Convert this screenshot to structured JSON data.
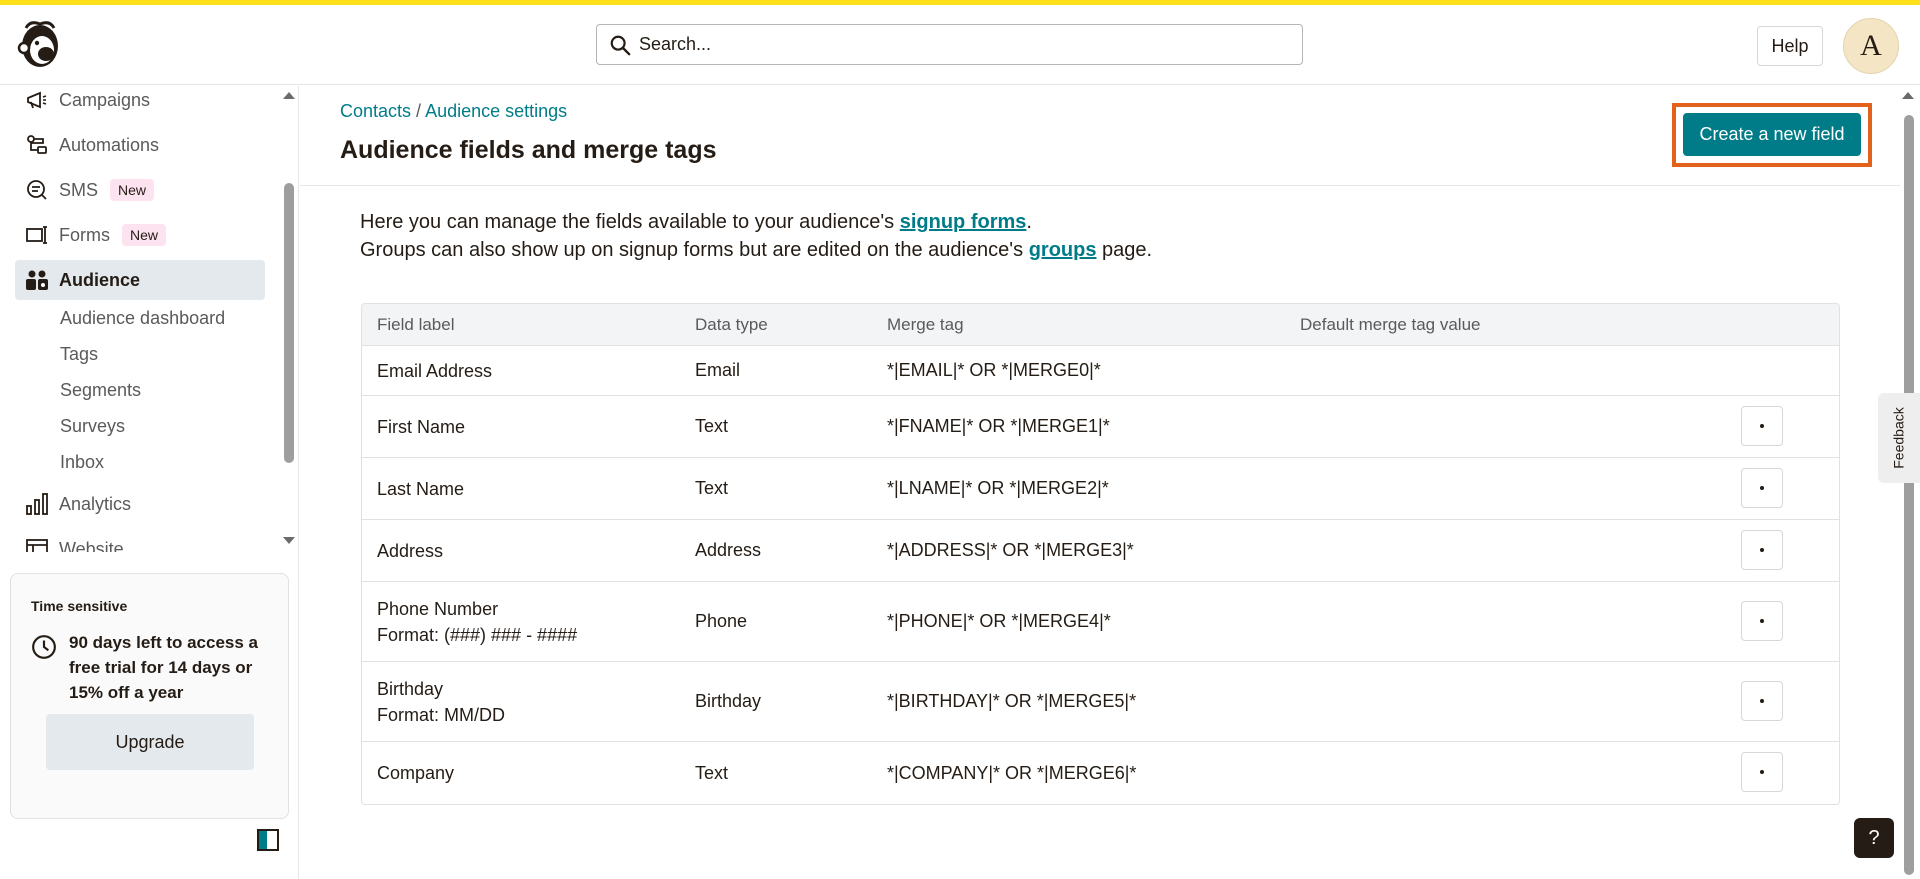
{
  "header": {
    "search_placeholder": "Search...",
    "help_label": "Help",
    "avatar_initial": "A"
  },
  "sidebar": {
    "items": [
      {
        "label": "Campaigns",
        "icon": "megaphone-icon"
      },
      {
        "label": "Automations",
        "icon": "automation-icon"
      },
      {
        "label": "SMS",
        "icon": "sms-icon",
        "badge": "New"
      },
      {
        "label": "Forms",
        "icon": "forms-icon",
        "badge": "New"
      },
      {
        "label": "Audience",
        "icon": "audience-icon",
        "active": true
      },
      {
        "label": "Analytics",
        "icon": "analytics-icon"
      },
      {
        "label": "Website",
        "icon": "website-icon"
      }
    ],
    "sub_items": [
      "Audience dashboard",
      "Tags",
      "Segments",
      "Surveys",
      "Inbox"
    ],
    "trial": {
      "title": "Time sensitive",
      "text": "90 days left to access a free trial for 14 days or 15% off a year",
      "upgrade_label": "Upgrade"
    }
  },
  "main": {
    "breadcrumb": {
      "parent": "Contacts",
      "separator": " / ",
      "current": "Audience settings"
    },
    "title": "Audience fields and merge tags",
    "create_button": "Create a new field",
    "intro": {
      "line1_pre": "Here you can manage the fields available to your audience's ",
      "line1_link": "signup forms",
      "line1_post": ".",
      "line2_pre": "Groups can also show up on signup forms but are edited on the audience's ",
      "line2_link": "groups",
      "line2_post": " page."
    },
    "table": {
      "headers": [
        "Field label",
        "Data type",
        "Merge tag",
        "Default merge tag value"
      ],
      "rows": [
        {
          "label": "Email Address",
          "format": "",
          "type": "Email",
          "tag": "*|EMAIL|* OR *|MERGE0|*",
          "default": "",
          "has_menu": false
        },
        {
          "label": "First Name",
          "format": "",
          "type": "Text",
          "tag": "*|FNAME|* OR *|MERGE1|*",
          "default": "",
          "has_menu": true
        },
        {
          "label": "Last Name",
          "format": "",
          "type": "Text",
          "tag": "*|LNAME|* OR *|MERGE2|*",
          "default": "",
          "has_menu": true
        },
        {
          "label": "Address",
          "format": "",
          "type": "Address",
          "tag": "*|ADDRESS|* OR *|MERGE3|*",
          "default": "",
          "has_menu": true
        },
        {
          "label": "Phone Number",
          "format": "Format: (###) ### - ####",
          "type": "Phone",
          "tag": "*|PHONE|* OR *|MERGE4|*",
          "default": "",
          "has_menu": true
        },
        {
          "label": "Birthday",
          "format": "Format: MM/DD",
          "type": "Birthday",
          "tag": "*|BIRTHDAY|* OR *|MERGE5|*",
          "default": "",
          "has_menu": true
        },
        {
          "label": "Company",
          "format": "",
          "type": "Text",
          "tag": "*|COMPANY|* OR *|MERGE6|*",
          "default": "",
          "has_menu": true
        }
      ]
    }
  },
  "feedback_label": "Feedback",
  "help_fab": "?",
  "colors": {
    "accent": "#007c89",
    "brand_yellow": "#ffe01b",
    "highlight": "#e2621b",
    "new_badge": "#fde2ef"
  }
}
